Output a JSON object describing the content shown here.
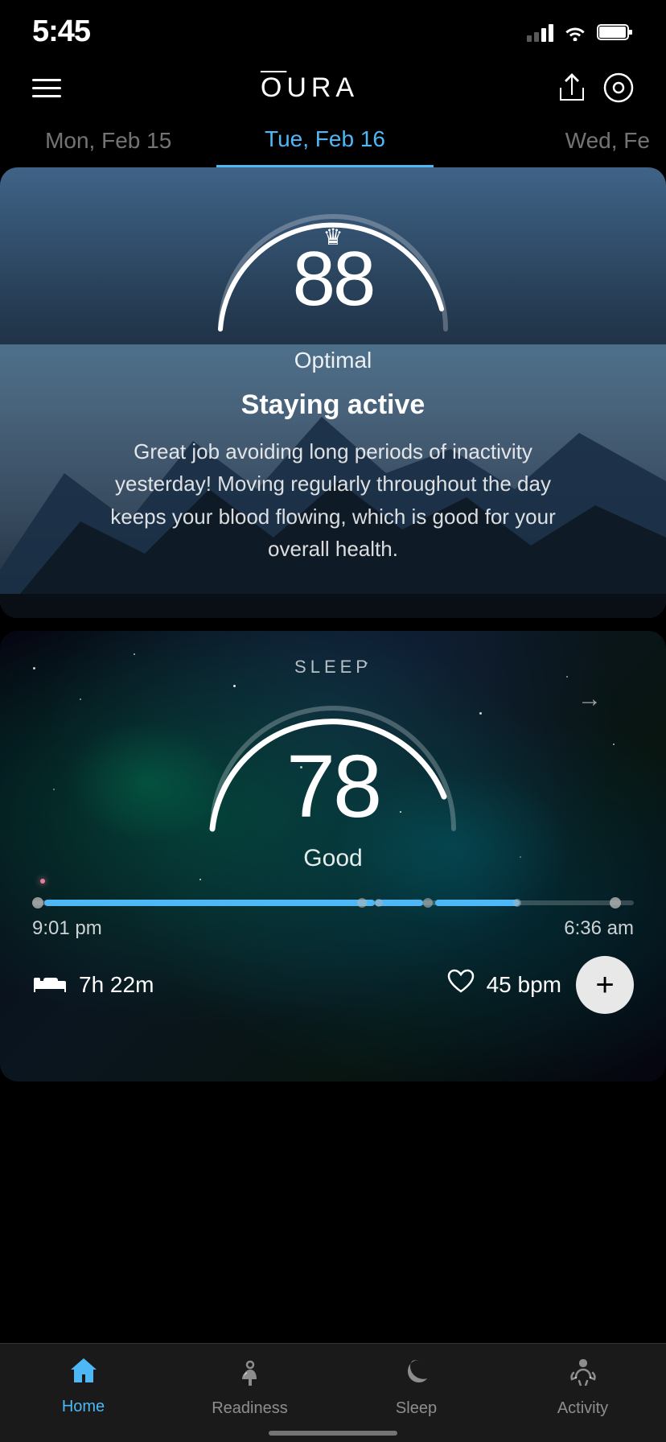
{
  "statusBar": {
    "time": "5:45"
  },
  "header": {
    "logo": "ŌURA"
  },
  "dateNav": {
    "prev": "Mon, Feb 15",
    "current": "Tue, Feb 16",
    "next": "Wed, Fe"
  },
  "mainCard": {
    "score": "88",
    "scoreLabel": "Optimal",
    "insightTitle": "Staying active",
    "insightText": "Great job avoiding long periods of inactivity yesterday! Moving regularly throughout the day keeps your blood flowing, which is good for your overall health."
  },
  "sleepCard": {
    "sectionLabel": "SLEEP",
    "score": "78",
    "scoreLabel": "Good",
    "timeStart": "9:01 pm",
    "timeEnd": "6:36 am",
    "duration": "7h 22m",
    "heartRate": "45 bpm"
  },
  "bottomNav": {
    "items": [
      {
        "id": "home",
        "label": "Home",
        "active": true
      },
      {
        "id": "readiness",
        "label": "Readiness",
        "active": false
      },
      {
        "id": "sleep",
        "label": "Sleep",
        "active": false
      },
      {
        "id": "activity",
        "label": "Activity",
        "active": false
      }
    ]
  }
}
